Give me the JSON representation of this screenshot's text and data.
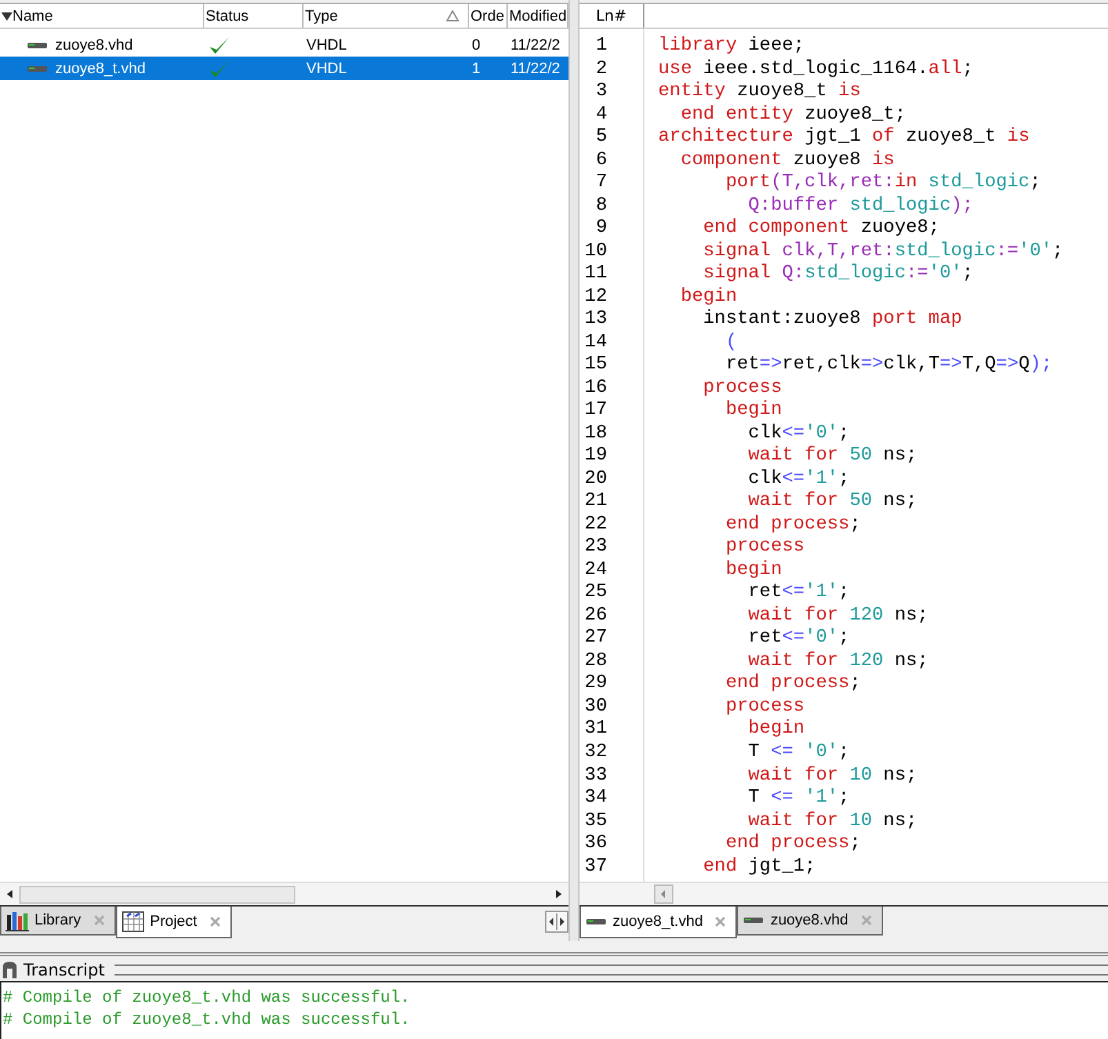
{
  "project": {
    "columns": [
      {
        "label": "Name",
        "sorted": false
      },
      {
        "label": "Status",
        "sorted": false
      },
      {
        "label": "Type",
        "sorted": true
      },
      {
        "label": "Orde",
        "sorted": false
      },
      {
        "label": "Modified",
        "sorted": false
      }
    ],
    "rows": [
      {
        "name": "zuoye8.vhd",
        "compiled": true,
        "type": "VHDL",
        "order": "0",
        "modified": "11/22/2",
        "selected": false
      },
      {
        "name": "zuoye8_t.vhd",
        "compiled": true,
        "type": "VHDL",
        "order": "1",
        "modified": "11/22/2",
        "selected": true
      }
    ]
  },
  "panel_tabs": [
    {
      "label": "Library",
      "kind": "library",
      "selected": false
    },
    {
      "label": "Project",
      "kind": "project",
      "selected": true
    }
  ],
  "editor": {
    "header": "Ln#",
    "lines": [
      {
        "number": "1",
        "segments": [
          {
            "text": "library",
            "kind": "keyword"
          },
          {
            "text": " ieee;",
            "kind": "plain"
          }
        ]
      },
      {
        "number": "2",
        "segments": [
          {
            "text": "use",
            "kind": "keyword"
          },
          {
            "text": " ieee.std_logic_1164.",
            "kind": "plain"
          },
          {
            "text": "all",
            "kind": "keyword"
          },
          {
            "text": ";",
            "kind": "plain"
          }
        ]
      },
      {
        "number": "3",
        "segments": [
          {
            "text": "entity",
            "kind": "keyword"
          },
          {
            "text": " zuoye8_t ",
            "kind": "plain"
          },
          {
            "text": "is",
            "kind": "keyword"
          }
        ]
      },
      {
        "number": "4",
        "segments": [
          {
            "text": "  end entity",
            "kind": "keyword"
          },
          {
            "text": " zuoye8_t;",
            "kind": "plain"
          }
        ]
      },
      {
        "number": "5",
        "segments": [
          {
            "text": "architecture",
            "kind": "keyword"
          },
          {
            "text": " jgt_1 ",
            "kind": "plain"
          },
          {
            "text": "of",
            "kind": "keyword"
          },
          {
            "text": " zuoye8_t ",
            "kind": "plain"
          },
          {
            "text": "is",
            "kind": "keyword"
          }
        ]
      },
      {
        "number": "6",
        "segments": [
          {
            "text": "  component",
            "kind": "keyword"
          },
          {
            "text": " zuoye8 ",
            "kind": "plain"
          },
          {
            "text": "is",
            "kind": "keyword"
          }
        ]
      },
      {
        "number": "7",
        "segments": [
          {
            "text": "      port",
            "kind": "keyword"
          },
          {
            "text": "(T,clk,ret:",
            "kind": "signal"
          },
          {
            "text": "in",
            "kind": "keyword"
          },
          {
            "text": " std_logic",
            "kind": "type"
          },
          {
            "text": ";",
            "kind": "plain"
          }
        ]
      },
      {
        "number": "8",
        "segments": [
          {
            "text": "        Q:buffer",
            "kind": "signal"
          },
          {
            "text": " std_logic",
            "kind": "type"
          },
          {
            "text": ");",
            "kind": "signal"
          }
        ]
      },
      {
        "number": "9",
        "segments": [
          {
            "text": "    end component",
            "kind": "keyword"
          },
          {
            "text": " zuoye8;",
            "kind": "plain"
          }
        ]
      },
      {
        "number": "10",
        "segments": [
          {
            "text": "    signal",
            "kind": "keyword"
          },
          {
            "text": " clk,T,ret:",
            "kind": "signal"
          },
          {
            "text": "std_logic",
            "kind": "type"
          },
          {
            "text": ":=",
            "kind": "signal"
          },
          {
            "text": "'0'",
            "kind": "type"
          },
          {
            "text": ";",
            "kind": "plain"
          }
        ]
      },
      {
        "number": "11",
        "segments": [
          {
            "text": "    signal",
            "kind": "keyword"
          },
          {
            "text": " Q:",
            "kind": "signal"
          },
          {
            "text": "std_logic",
            "kind": "type"
          },
          {
            "text": ":=",
            "kind": "signal"
          },
          {
            "text": "'0'",
            "kind": "type"
          },
          {
            "text": ";",
            "kind": "plain"
          }
        ]
      },
      {
        "number": "12",
        "segments": [
          {
            "text": "  begin",
            "kind": "keyword"
          }
        ]
      },
      {
        "number": "13",
        "segments": [
          {
            "text": "    instant:zuoye8 ",
            "kind": "plain"
          },
          {
            "text": "port map",
            "kind": "keyword"
          }
        ]
      },
      {
        "number": "14",
        "segments": [
          {
            "text": "      (",
            "kind": "operator"
          }
        ]
      },
      {
        "number": "15",
        "segments": [
          {
            "text": "      ret",
            "kind": "plain"
          },
          {
            "text": "=>",
            "kind": "operator"
          },
          {
            "text": "ret,clk",
            "kind": "plain"
          },
          {
            "text": "=>",
            "kind": "operator"
          },
          {
            "text": "clk,T",
            "kind": "plain"
          },
          {
            "text": "=>",
            "kind": "operator"
          },
          {
            "text": "T,Q",
            "kind": "plain"
          },
          {
            "text": "=>",
            "kind": "operator"
          },
          {
            "text": "Q",
            "kind": "plain"
          },
          {
            "text": ");",
            "kind": "operator"
          }
        ]
      },
      {
        "number": "16",
        "segments": [
          {
            "text": "    process",
            "kind": "keyword"
          }
        ]
      },
      {
        "number": "17",
        "segments": [
          {
            "text": "      begin",
            "kind": "keyword"
          }
        ]
      },
      {
        "number": "18",
        "segments": [
          {
            "text": "        clk",
            "kind": "plain"
          },
          {
            "text": "<=",
            "kind": "operator"
          },
          {
            "text": "'0'",
            "kind": "type"
          },
          {
            "text": ";",
            "kind": "plain"
          }
        ]
      },
      {
        "number": "19",
        "segments": [
          {
            "text": "        wait for",
            "kind": "keyword"
          },
          {
            "text": " 50",
            "kind": "type"
          },
          {
            "text": " ns;",
            "kind": "plain"
          }
        ]
      },
      {
        "number": "20",
        "segments": [
          {
            "text": "        clk",
            "kind": "plain"
          },
          {
            "text": "<=",
            "kind": "operator"
          },
          {
            "text": "'1'",
            "kind": "type"
          },
          {
            "text": ";",
            "kind": "plain"
          }
        ]
      },
      {
        "number": "21",
        "segments": [
          {
            "text": "        wait for",
            "kind": "keyword"
          },
          {
            "text": " 50",
            "kind": "type"
          },
          {
            "text": " ns;",
            "kind": "plain"
          }
        ]
      },
      {
        "number": "22",
        "segments": [
          {
            "text": "      end process",
            "kind": "keyword"
          },
          {
            "text": ";",
            "kind": "plain"
          }
        ]
      },
      {
        "number": "23",
        "segments": [
          {
            "text": "      process",
            "kind": "keyword"
          }
        ]
      },
      {
        "number": "24",
        "segments": [
          {
            "text": "      begin",
            "kind": "keyword"
          }
        ]
      },
      {
        "number": "25",
        "segments": [
          {
            "text": "        ret",
            "kind": "plain"
          },
          {
            "text": "<=",
            "kind": "operator"
          },
          {
            "text": "'1'",
            "kind": "type"
          },
          {
            "text": ";",
            "kind": "plain"
          }
        ]
      },
      {
        "number": "26",
        "segments": [
          {
            "text": "        wait for",
            "kind": "keyword"
          },
          {
            "text": " 120",
            "kind": "type"
          },
          {
            "text": " ns;",
            "kind": "plain"
          }
        ]
      },
      {
        "number": "27",
        "segments": [
          {
            "text": "        ret",
            "kind": "plain"
          },
          {
            "text": "<=",
            "kind": "operator"
          },
          {
            "text": "'0'",
            "kind": "type"
          },
          {
            "text": ";",
            "kind": "plain"
          }
        ]
      },
      {
        "number": "28",
        "segments": [
          {
            "text": "        wait for",
            "kind": "keyword"
          },
          {
            "text": " 120",
            "kind": "type"
          },
          {
            "text": " ns;",
            "kind": "plain"
          }
        ]
      },
      {
        "number": "29",
        "segments": [
          {
            "text": "      end process",
            "kind": "keyword"
          },
          {
            "text": ";",
            "kind": "plain"
          }
        ]
      },
      {
        "number": "30",
        "segments": [
          {
            "text": "      process",
            "kind": "keyword"
          }
        ]
      },
      {
        "number": "31",
        "segments": [
          {
            "text": "        begin",
            "kind": "keyword"
          }
        ]
      },
      {
        "number": "32",
        "segments": [
          {
            "text": "        T ",
            "kind": "plain"
          },
          {
            "text": "<=",
            "kind": "operator"
          },
          {
            "text": " '0'",
            "kind": "type"
          },
          {
            "text": ";",
            "kind": "plain"
          }
        ]
      },
      {
        "number": "33",
        "segments": [
          {
            "text": "        wait for",
            "kind": "keyword"
          },
          {
            "text": " 10",
            "kind": "type"
          },
          {
            "text": " ns;",
            "kind": "plain"
          }
        ]
      },
      {
        "number": "34",
        "segments": [
          {
            "text": "        T ",
            "kind": "plain"
          },
          {
            "text": "<=",
            "kind": "operator"
          },
          {
            "text": " '1'",
            "kind": "type"
          },
          {
            "text": ";",
            "kind": "plain"
          }
        ]
      },
      {
        "number": "35",
        "segments": [
          {
            "text": "        wait for",
            "kind": "keyword"
          },
          {
            "text": " 10",
            "kind": "type"
          },
          {
            "text": " ns;",
            "kind": "plain"
          }
        ]
      },
      {
        "number": "36",
        "segments": [
          {
            "text": "      end process",
            "kind": "keyword"
          },
          {
            "text": ";",
            "kind": "plain"
          }
        ]
      },
      {
        "number": "37",
        "segments": [
          {
            "text": "    end",
            "kind": "keyword"
          },
          {
            "text": " jgt_1;",
            "kind": "plain"
          }
        ]
      }
    ]
  },
  "editor_tabs": [
    {
      "label": "zuoye8_t.vhd",
      "selected": true
    },
    {
      "label": "zuoye8.vhd",
      "selected": false
    }
  ],
  "transcript": {
    "title": "Transcript",
    "lines": [
      "# Compile of zuoye8_t.vhd was successful.",
      "# Compile of zuoye8_t.vhd was successful."
    ]
  }
}
